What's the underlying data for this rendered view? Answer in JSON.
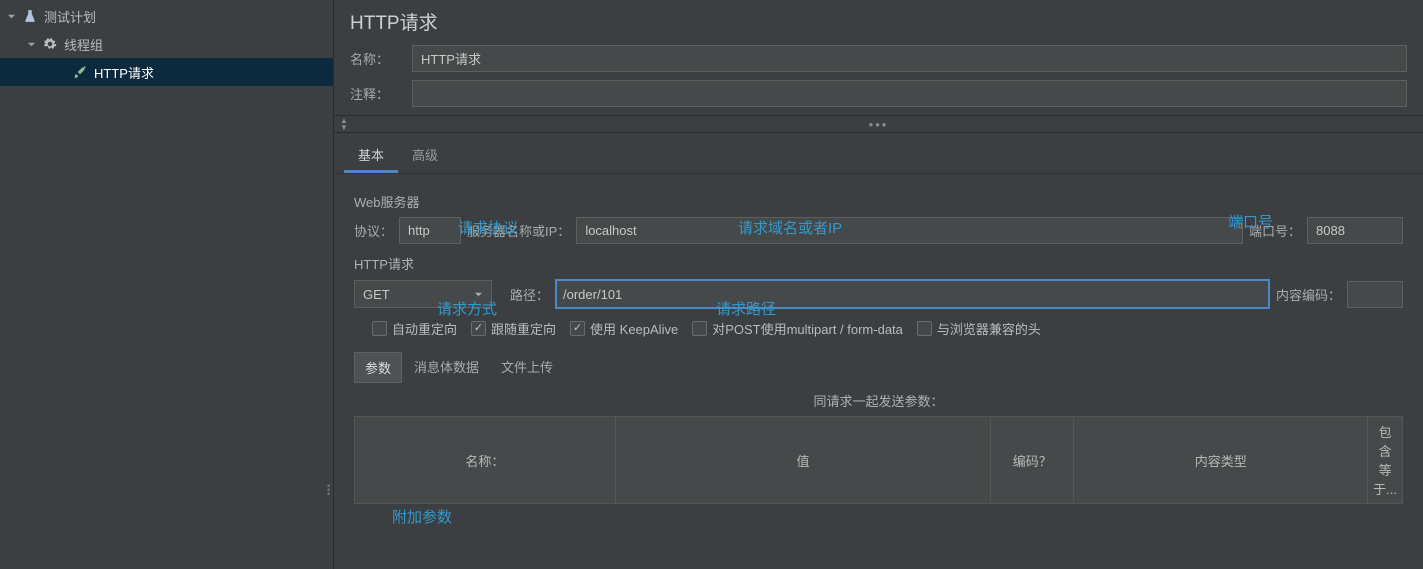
{
  "tree": {
    "root": "测试计划",
    "group": "线程组",
    "request": "HTTP请求"
  },
  "panel": {
    "title": "HTTP请求",
    "name_label": "名称：",
    "name_value": "HTTP请求",
    "comment_label": "注释：",
    "comment_value": ""
  },
  "tabs": {
    "basic": "基本",
    "advanced": "高级"
  },
  "webserver": {
    "section": "Web服务器",
    "protocol_label": "协议：",
    "protocol_value": "http",
    "server_label": "服务器名称或IP：",
    "server_value": "localhost",
    "port_label": "端口号：",
    "port_value": "8088"
  },
  "httpreq": {
    "section": "HTTP请求",
    "method": "GET",
    "path_label": "路径：",
    "path_value": "/order/101",
    "encoding_label": "内容编码：",
    "encoding_value": ""
  },
  "checkboxes": {
    "auto_redirect": "自动重定向",
    "follow_redirect": "跟随重定向",
    "keepalive": "使用 KeepAlive",
    "multipart": "对POST使用multipart / form-data",
    "browser_compat": "与浏览器兼容的头"
  },
  "subtabs": {
    "params": "参数",
    "body": "消息体数据",
    "files": "文件上传"
  },
  "params_section": {
    "title": "同请求一起发送参数：",
    "col_name": "名称：",
    "col_value": "值",
    "col_encode": "编码？",
    "col_ctype": "内容类型",
    "col_include": "包含等于..."
  },
  "annotations": {
    "protocol": "请求协议",
    "domain": "请求域名或者IP",
    "port": "端口号",
    "method": "请求方式",
    "path": "请求路径",
    "extra": "附加参数"
  }
}
